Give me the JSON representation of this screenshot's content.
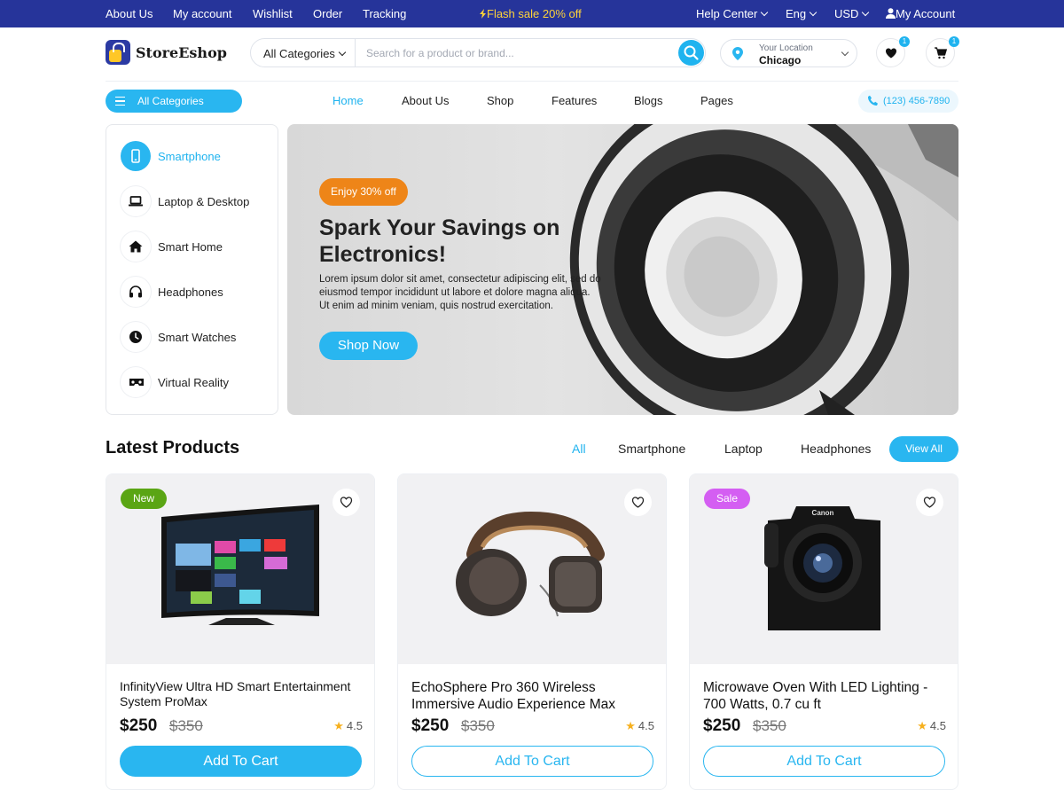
{
  "topbar": {
    "links": [
      "About Us",
      "My account",
      "Wishlist",
      "Order",
      "Tracking"
    ],
    "flash": "Flash sale 20% off",
    "help": "Help Center",
    "language": "Eng",
    "currency": "USD",
    "account": "My Account"
  },
  "header": {
    "logo": "StoreEshop",
    "category_select": "All Categories",
    "search_placeholder": "Search for a product or brand...",
    "location_label": "Your Location",
    "location_value": "Chicago",
    "wishlist_count": "1",
    "cart_count": "1"
  },
  "nav": {
    "all_categories": "All Categories",
    "links": [
      "Home",
      "About Us",
      "Shop",
      "Features",
      "Blogs",
      "Pages"
    ],
    "active": "Home",
    "phone": "(123) 456-7890"
  },
  "categories": [
    {
      "label": "Smartphone",
      "icon": "smartphone-icon",
      "active": true
    },
    {
      "label": "Laptop & Desktop",
      "icon": "laptop-icon"
    },
    {
      "label": "Smart Home",
      "icon": "home-icon"
    },
    {
      "label": "Headphones",
      "icon": "headphones-icon"
    },
    {
      "label": "Smart Watches",
      "icon": "clock-icon"
    },
    {
      "label": "Virtual Reality",
      "icon": "vr-headset-icon"
    }
  ],
  "hero": {
    "badge": "Enjoy 30% off",
    "title": "Spark Your Savings on Electronics!",
    "description": "Lorem ipsum dolor sit amet, consectetur adipiscing elit, sed do eiusmod tempor incididunt ut labore et dolore magna aliqua. Ut enim ad minim veniam, quis nostrud exercitation.",
    "button": "Shop Now"
  },
  "latest": {
    "title": "Latest Products",
    "filters": [
      "All",
      "Smartphone",
      "Laptop",
      "Headphones"
    ],
    "active_filter": "All",
    "view_all": "View All",
    "products": [
      {
        "tag": "New",
        "tag_color": "#5aa514",
        "name": "InfinityView Ultra HD Smart Entertainment System ProMax",
        "price": "$250",
        "old_price": "$350",
        "rating": "4.5",
        "button": "Add To Cart",
        "image": "tv-image"
      },
      {
        "tag": "",
        "name": "EchoSphere Pro 360 Wireless Immersive Audio Experience Max",
        "price": "$250",
        "old_price": "$350",
        "rating": "4.5",
        "button": "Add To Cart",
        "image": "headphones-image"
      },
      {
        "tag": "Sale",
        "tag_color": "#d45ef2",
        "name": "Microwave Oven With LED Lighting - 700 Watts, 0.7 cu ft",
        "price": "$250",
        "old_price": "$350",
        "rating": "4.5",
        "button": "Add To Cart",
        "image": "camera-image"
      }
    ]
  },
  "colors": {
    "topbar": "#26349a",
    "accent": "#29b6f0",
    "flash": "#ffd339",
    "hero_badge": "#ee8518"
  }
}
